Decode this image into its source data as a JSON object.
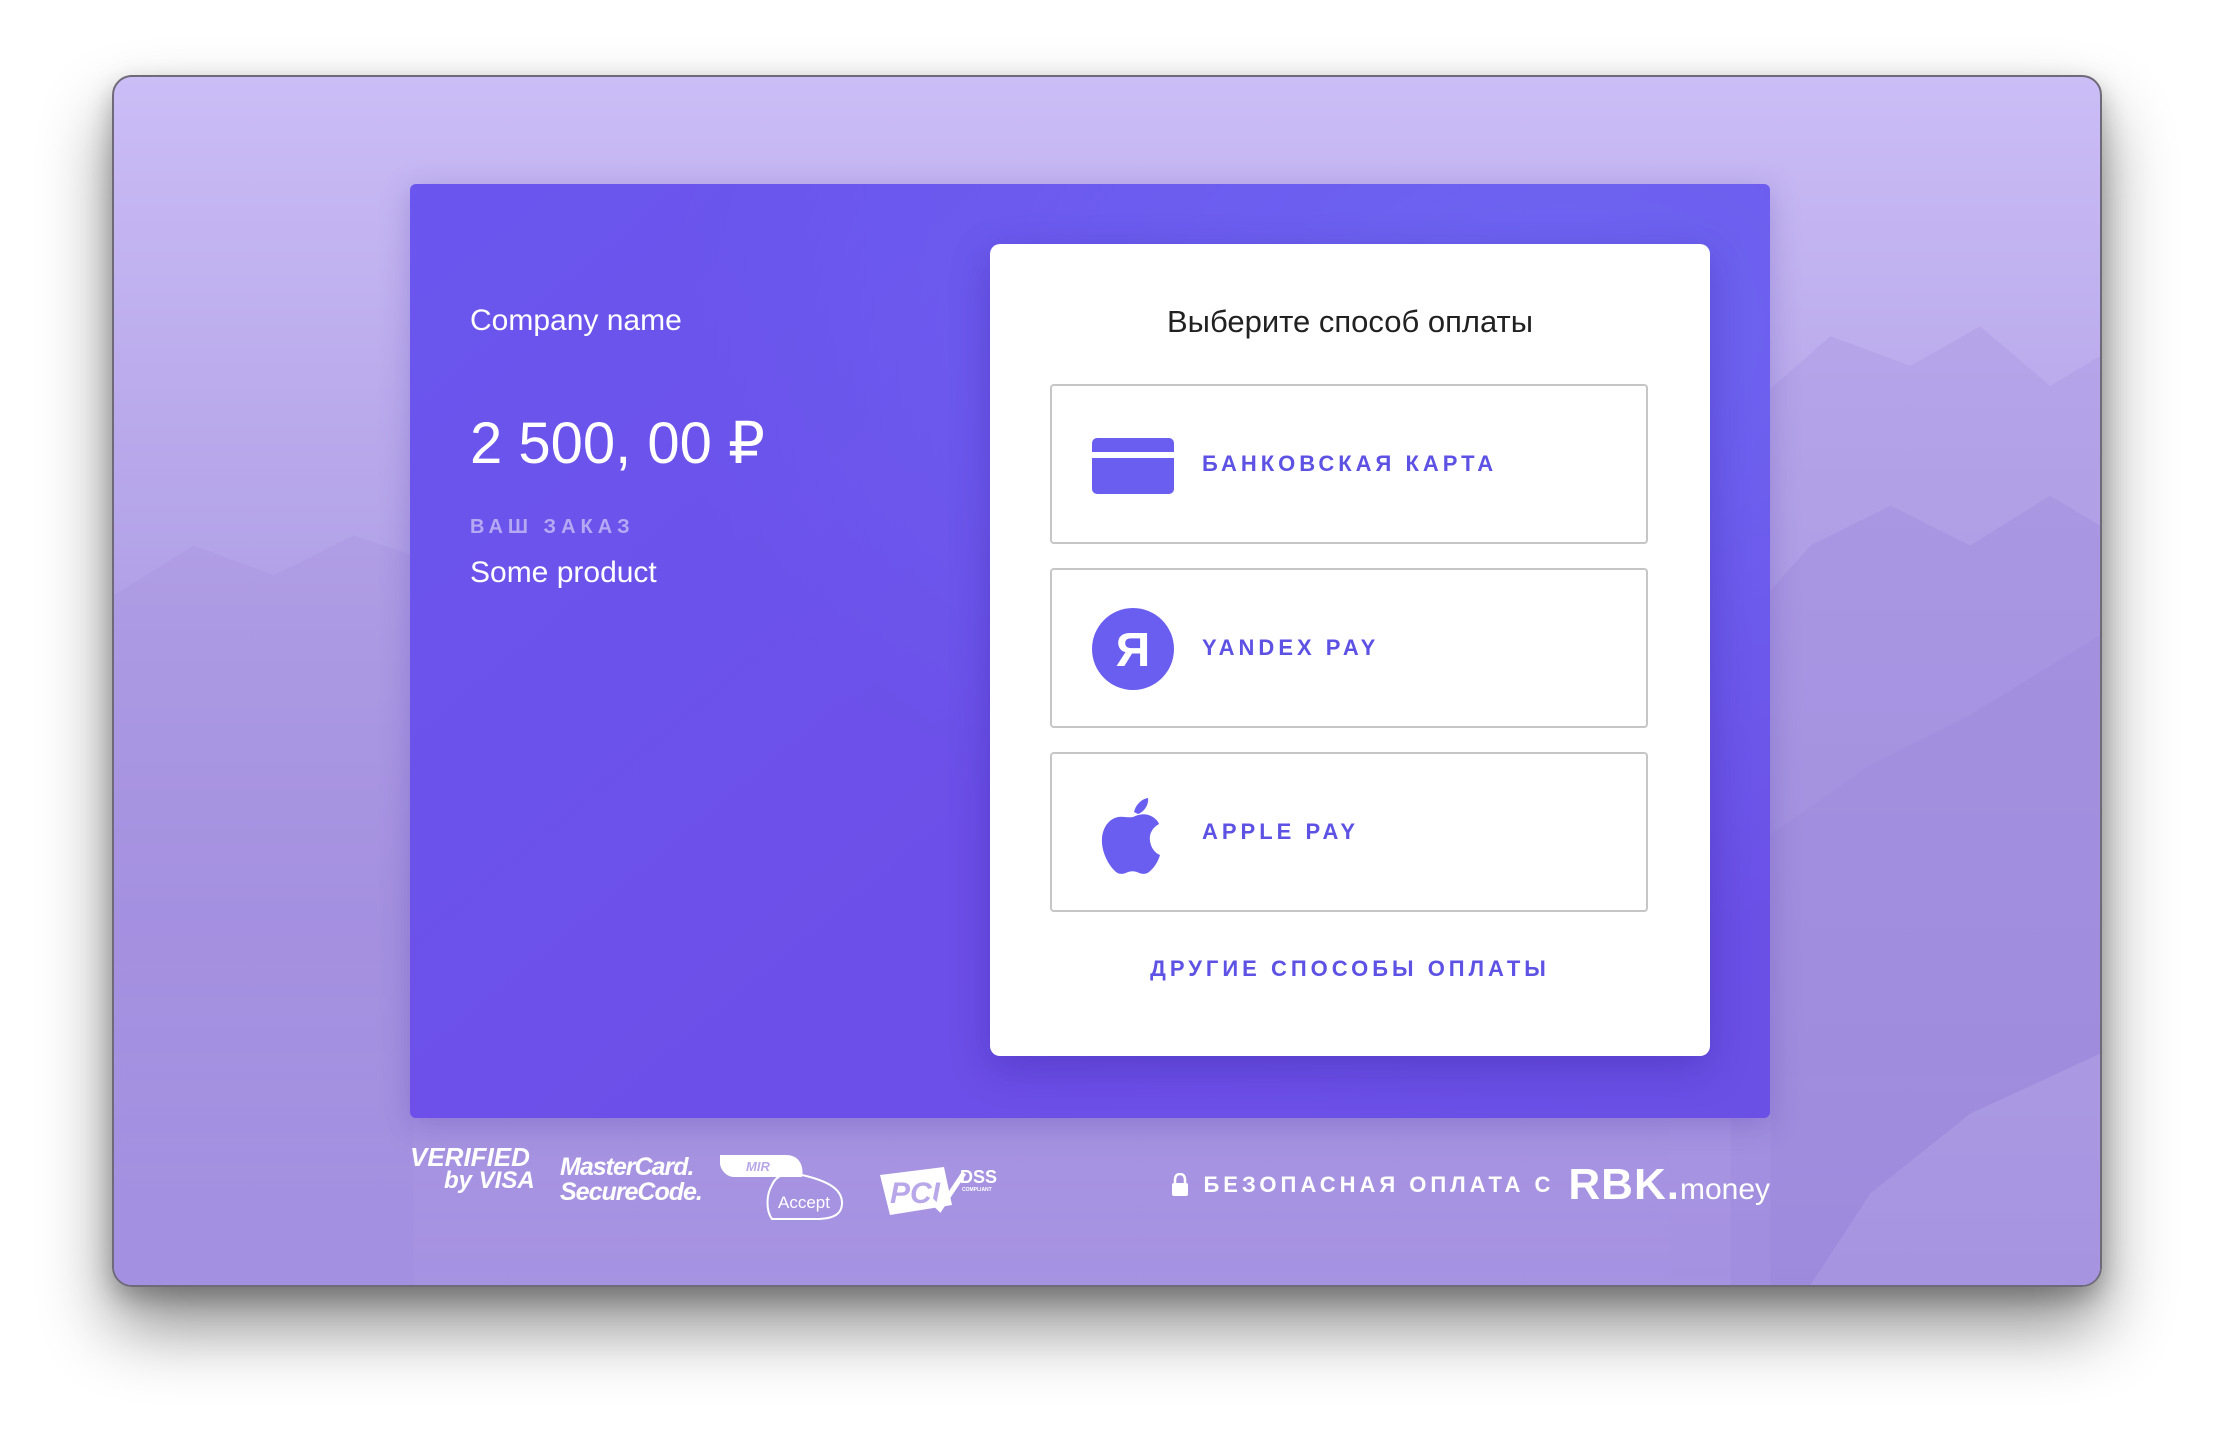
{
  "merchant": {
    "company_name": "Company name",
    "amount": "2 500, 00 ₽",
    "order_label": "ВАШ ЗАКАЗ",
    "order_value": "Some product"
  },
  "payment": {
    "title": "Выберите способ оплаты",
    "methods": [
      {
        "label": "БАНКОВСКАЯ КАРТА",
        "icon": "credit-card-icon"
      },
      {
        "label": "YANDEX PAY",
        "icon": "yandex-icon"
      },
      {
        "label": "APPLE PAY",
        "icon": "apple-icon"
      }
    ],
    "yandex_glyph": "Я",
    "other_methods": "ДРУГИЕ СПОСОБЫ ОПЛАТЫ"
  },
  "footer": {
    "verified_line1": "VERIFIED",
    "verified_line2": "by VISA",
    "mastercard_line1": "MasterCard.",
    "mastercard_line2": "SecureCode.",
    "mir_line1": "MIR",
    "mir_line2": "Accept",
    "pci_line1": "PCI",
    "pci_line2": "DSS",
    "pci_line3": "COMPLIANT",
    "secure_text": "БЕЗОПАСНАЯ ОПЛАТА С",
    "brand_main": "RBK.",
    "brand_suffix": "money"
  },
  "colors": {
    "accent": "#5d52e4",
    "panel": "#6a56ee",
    "background": "#b8a8ea"
  }
}
